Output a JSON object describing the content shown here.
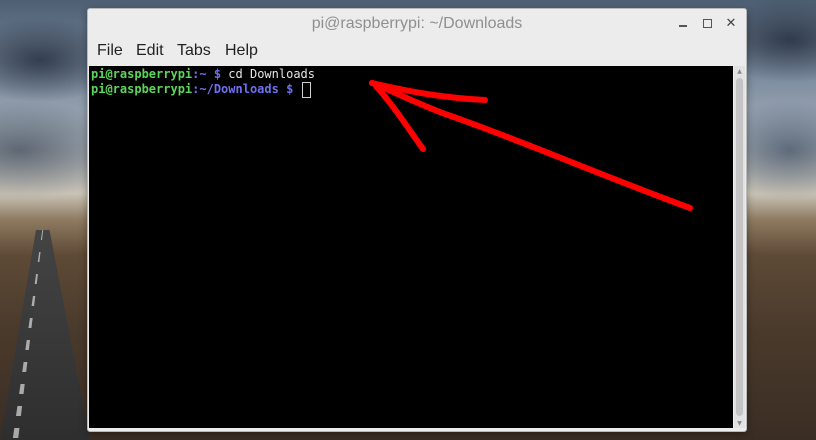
{
  "window": {
    "title": "pi@raspberrypi: ~/Downloads"
  },
  "menu": {
    "file": "File",
    "edit": "Edit",
    "tabs": "Tabs",
    "help": "Help"
  },
  "terminal": {
    "line1": {
      "user_host": "pi@raspberrypi",
      "path": ":~",
      "prompt": " $ ",
      "command": "cd Downloads"
    },
    "line2": {
      "user_host": "pi@raspberrypi",
      "path": ":~/Downloads",
      "prompt": " $ "
    }
  },
  "colors": {
    "prompt_user": "#5bd65b",
    "prompt_path": "#6f6ff2",
    "terminal_bg": "#000000",
    "annotation_arrow": "#ff0000"
  },
  "icons": [
    "minimize-icon",
    "maximize-icon",
    "close-icon",
    "scroll-up-arrow-icon",
    "scroll-down-arrow-icon"
  ]
}
